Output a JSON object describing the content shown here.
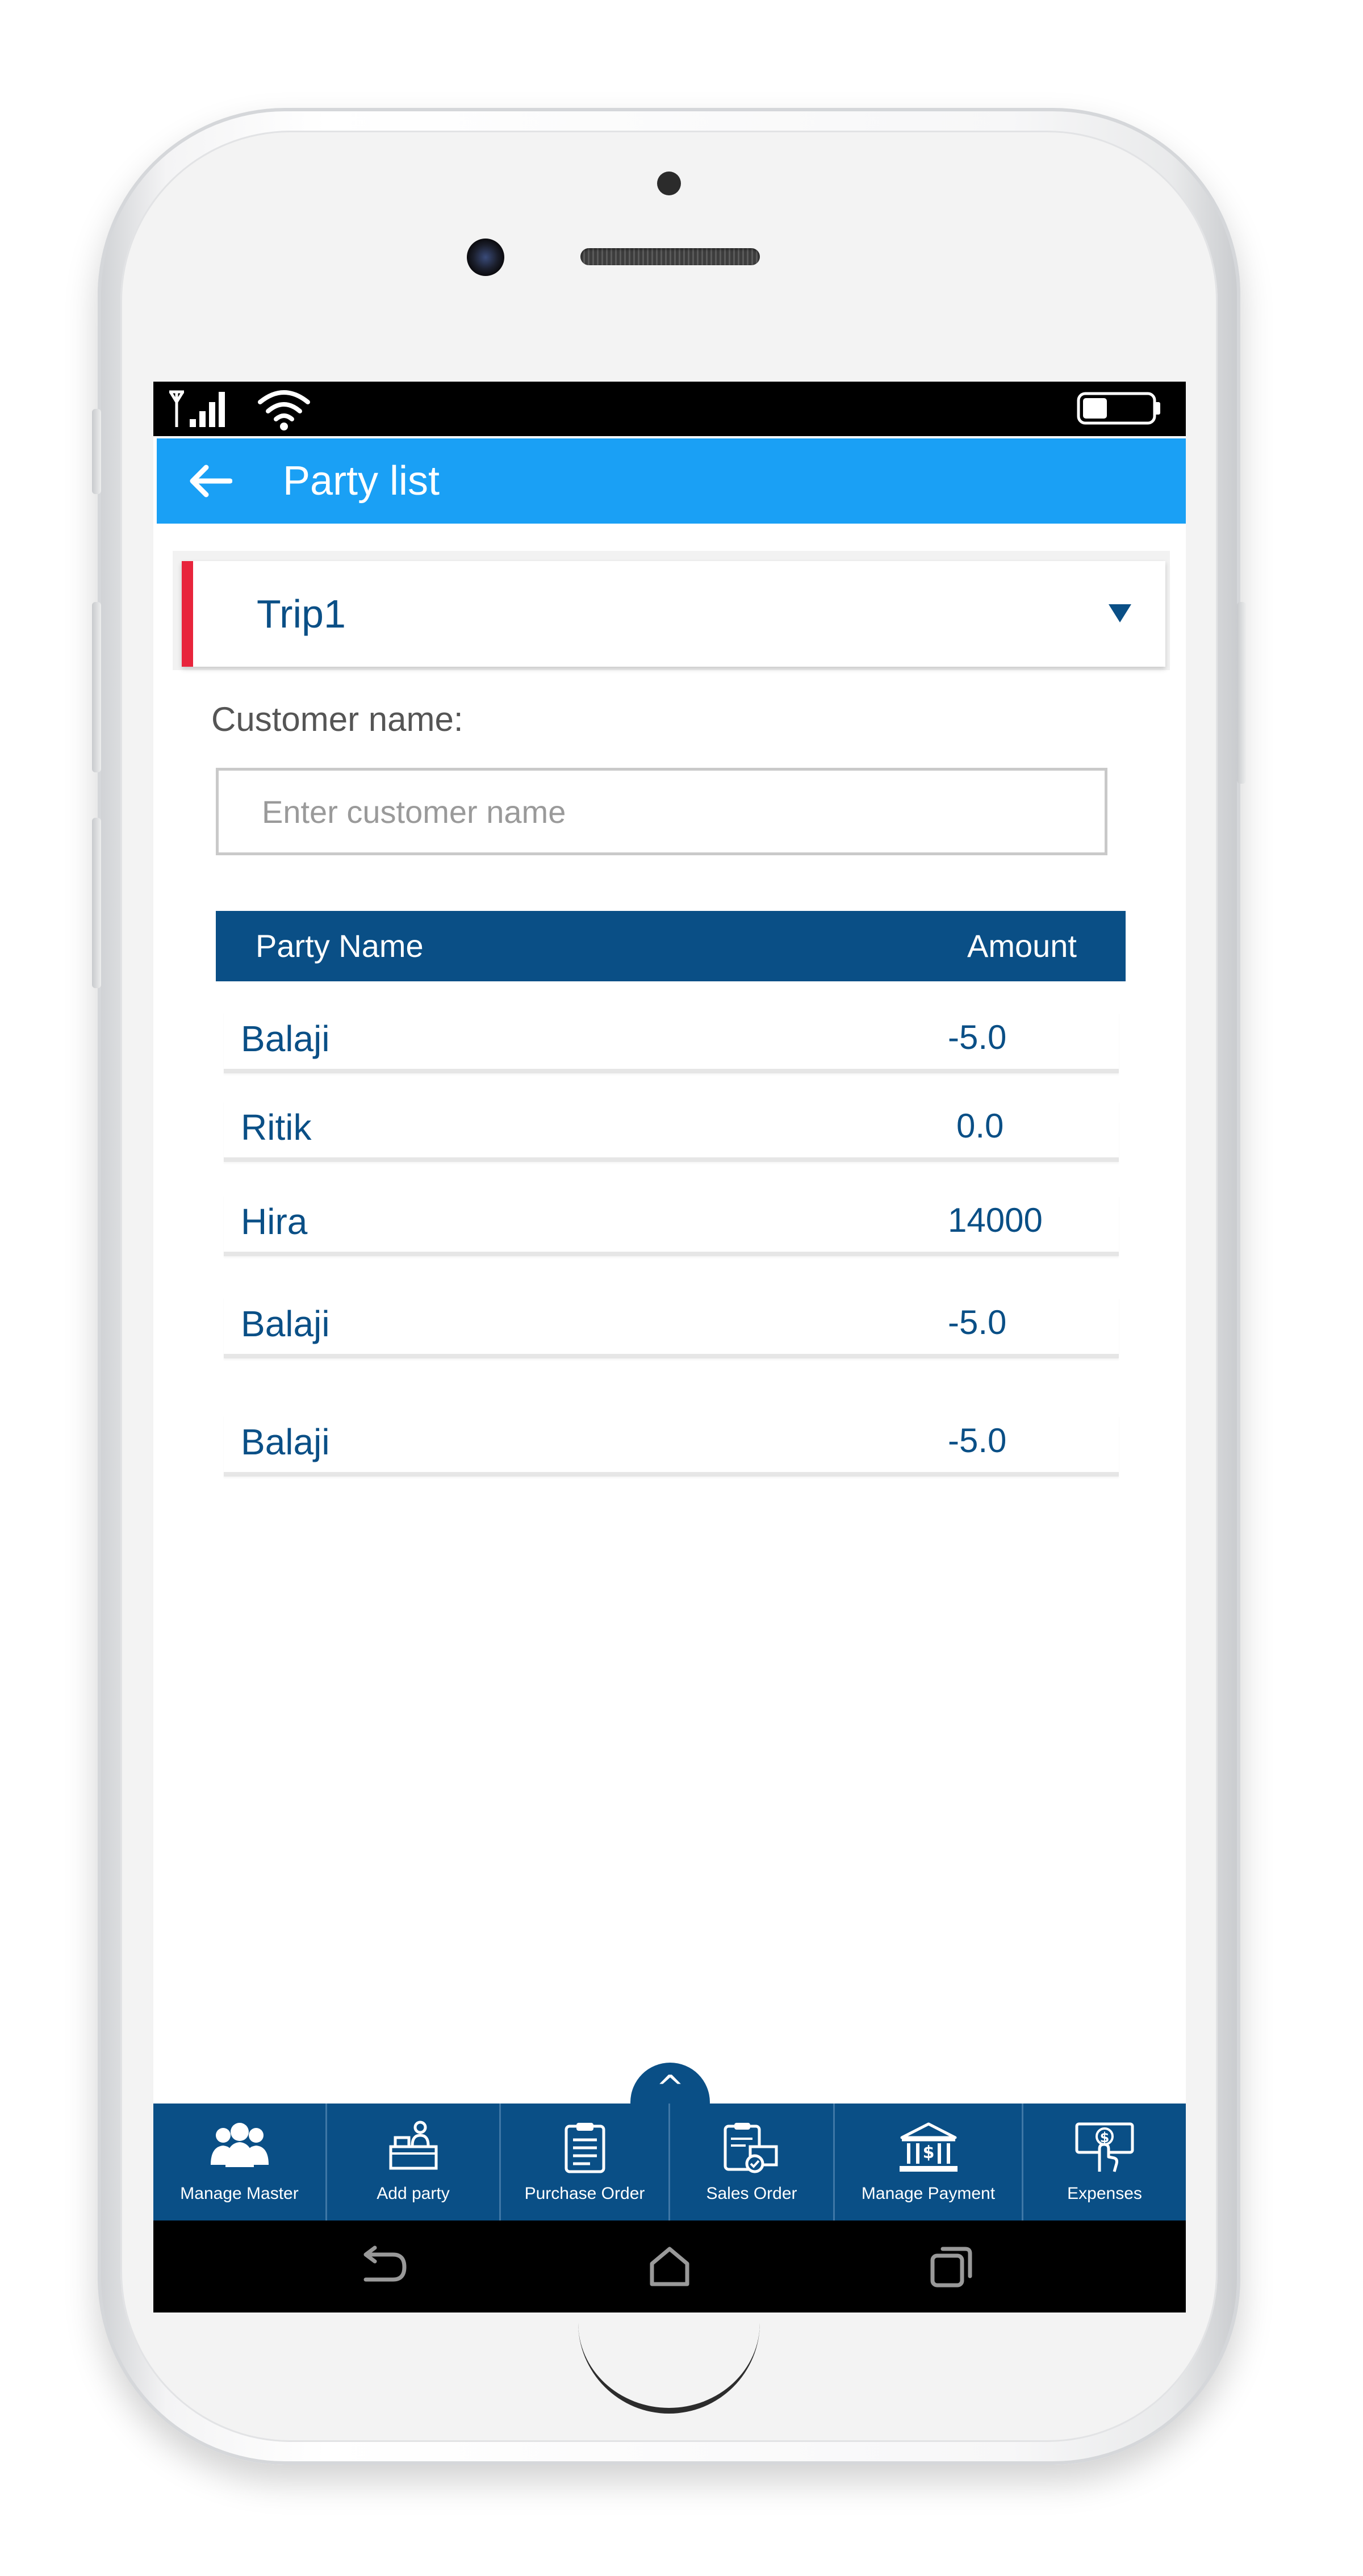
{
  "status_bar": {
    "signal_icon": "signal-bars-icon",
    "wifi_icon": "wifi-icon",
    "battery_icon": "battery-low-icon"
  },
  "app_bar": {
    "back_icon": "arrow-left-icon",
    "title": "Party list"
  },
  "trip_selector": {
    "selected": "Trip1",
    "accent_color": "#e8243c",
    "dropdown_icon": "triangle-down-icon"
  },
  "customer_search": {
    "label": "Customer name:",
    "placeholder": "Enter customer name",
    "value": ""
  },
  "party_table": {
    "headers": {
      "name": "Party Name",
      "amount": "Amount"
    },
    "rows": [
      {
        "name": "Balaji",
        "amount": "-5.0"
      },
      {
        "name": "Ritik",
        "amount": "0.0"
      },
      {
        "name": "Hira",
        "amount": "14000"
      },
      {
        "name": "Balaji",
        "amount": "-5.0"
      },
      {
        "name": "Balaji",
        "amount": "-5.0"
      }
    ]
  },
  "expand_button": {
    "label": "^"
  },
  "bottom_nav": {
    "items": [
      {
        "label": "Manage Master",
        "icon": "people-group-icon"
      },
      {
        "label": "Add party",
        "icon": "desk-person-icon"
      },
      {
        "label": "Purchase Order",
        "icon": "clipboard-list-icon"
      },
      {
        "label": "Sales Order",
        "icon": "clipboard-check-icon"
      },
      {
        "label": "Manage Payment",
        "icon": "bank-icon"
      },
      {
        "label": "Expenses",
        "icon": "hand-money-icon"
      }
    ]
  },
  "system_nav": {
    "back_icon": "system-back-icon",
    "home_icon": "system-home-icon",
    "recents_icon": "system-recents-icon"
  },
  "colors": {
    "app_bar": "#1aa0f5",
    "primary_dark": "#0a4f86",
    "accent": "#e8243c"
  }
}
